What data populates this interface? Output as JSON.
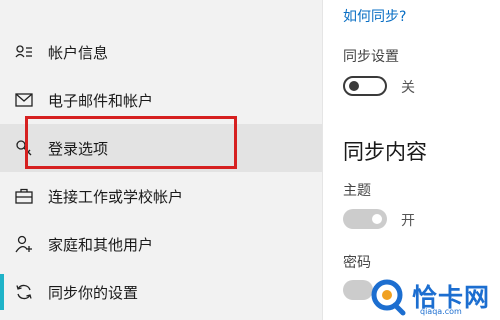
{
  "sidebar": {
    "items": [
      {
        "label": "帐户信息",
        "icon": "person-card-icon"
      },
      {
        "label": "电子邮件和帐户",
        "icon": "mail-icon"
      },
      {
        "label": "登录选项",
        "icon": "key-icon",
        "selected": true
      },
      {
        "label": "连接工作或学校帐户",
        "icon": "briefcase-icon"
      },
      {
        "label": "家庭和其他用户",
        "icon": "person-add-icon"
      },
      {
        "label": "同步你的设置",
        "icon": "sync-icon"
      }
    ],
    "accent_color": "#1fb3c8",
    "highlight_color": "#d62020"
  },
  "main": {
    "help_link": "如何同步?",
    "sync_settings": {
      "label": "同步设置",
      "state": "关"
    },
    "section_title": "同步内容",
    "theme": {
      "label": "主题",
      "state": "开"
    },
    "password": {
      "label": "密码"
    }
  },
  "watermark": {
    "text": "恰卡网",
    "sub": "qiaqa.com"
  }
}
